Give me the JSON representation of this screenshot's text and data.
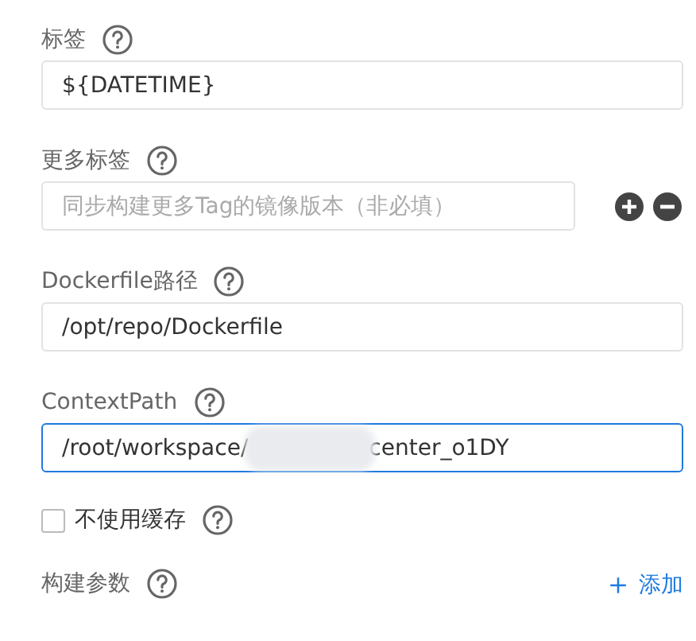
{
  "fields": [
    {
      "kind": "input",
      "label": "标签",
      "value": "${DATETIME}",
      "focused": false
    },
    {
      "kind": "input-actions",
      "label": "更多标签",
      "placeholder": "同步构建更多Tag的镜像版本（非必填）",
      "focused": false
    },
    {
      "kind": "input",
      "label": "Dockerfile路径",
      "value": "/opt/repo/Dockerfile",
      "focused": false
    },
    {
      "kind": "input-redacted",
      "label": "ContextPath",
      "value_start": "/root/workspace/",
      "value_end": "center_o1DY",
      "focused": true
    },
    {
      "kind": "checkbox",
      "label": "不使用缓存",
      "checked": false
    },
    {
      "kind": "list-header",
      "label": "构建参数",
      "action": "添加"
    }
  ]
}
